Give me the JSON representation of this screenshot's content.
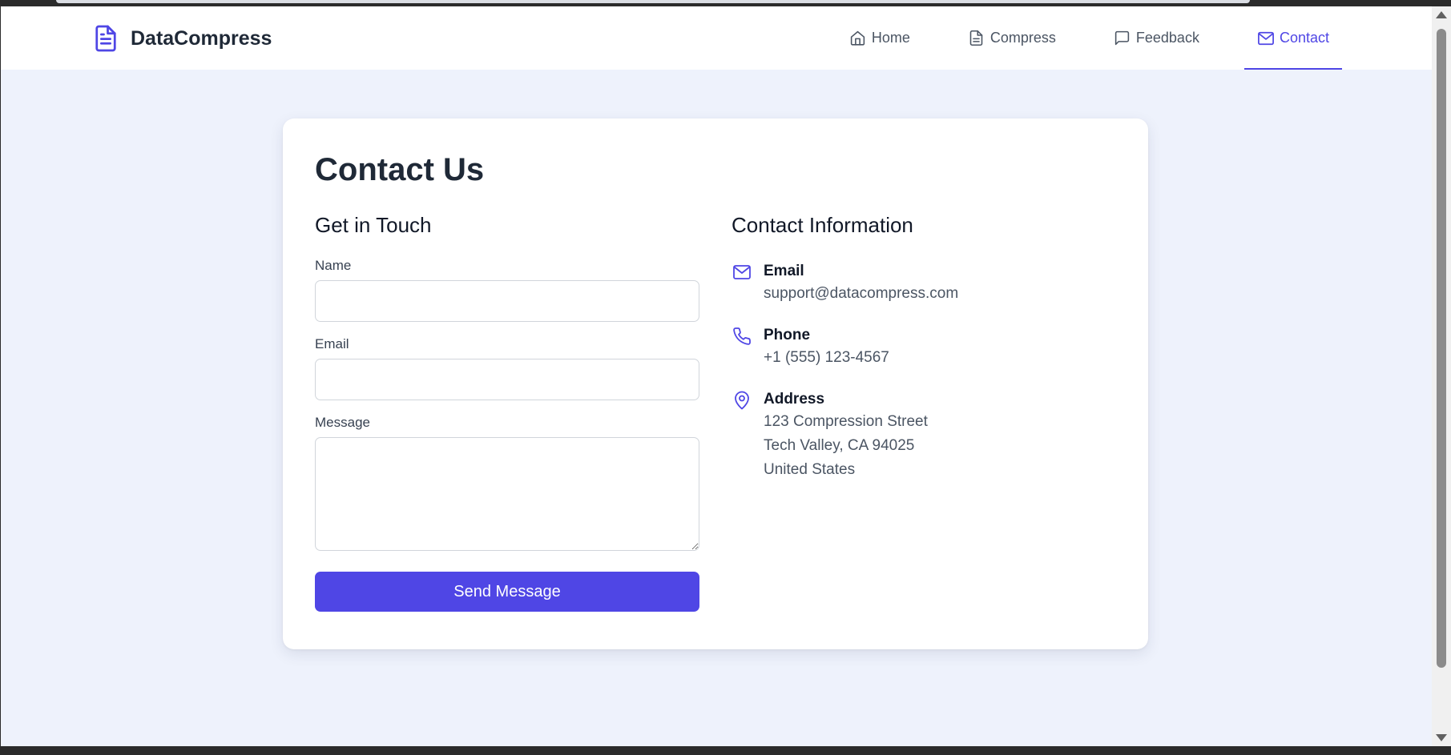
{
  "brand": {
    "name": "DataCompress",
    "icon": "document-icon"
  },
  "nav": {
    "items": [
      {
        "label": "Home",
        "icon": "home-icon",
        "active": false
      },
      {
        "label": "Compress",
        "icon": "document-icon",
        "active": false
      },
      {
        "label": "Feedback",
        "icon": "chat-bubble-icon",
        "active": false
      },
      {
        "label": "Contact",
        "icon": "mail-icon",
        "active": true
      }
    ]
  },
  "page": {
    "title": "Contact Us"
  },
  "form": {
    "heading": "Get in Touch",
    "name_label": "Name",
    "name_value": "",
    "email_label": "Email",
    "email_value": "",
    "message_label": "Message",
    "message_value": "",
    "submit_label": "Send Message"
  },
  "contact_info": {
    "heading": "Contact Information",
    "email": {
      "title": "Email",
      "value": "support@datacompress.com",
      "icon": "mail-icon"
    },
    "phone": {
      "title": "Phone",
      "value": "+1 (555) 123-4567",
      "icon": "phone-icon"
    },
    "address": {
      "title": "Address",
      "icon": "map-pin-icon",
      "lines": [
        "123 Compression Street",
        "Tech Valley, CA 94025",
        "United States"
      ]
    }
  },
  "colors": {
    "accent": "#4f46e5",
    "page_background": "#eef2fc",
    "card_background": "#ffffff",
    "text_primary": "#1f2937",
    "text_secondary": "#4b5563"
  }
}
